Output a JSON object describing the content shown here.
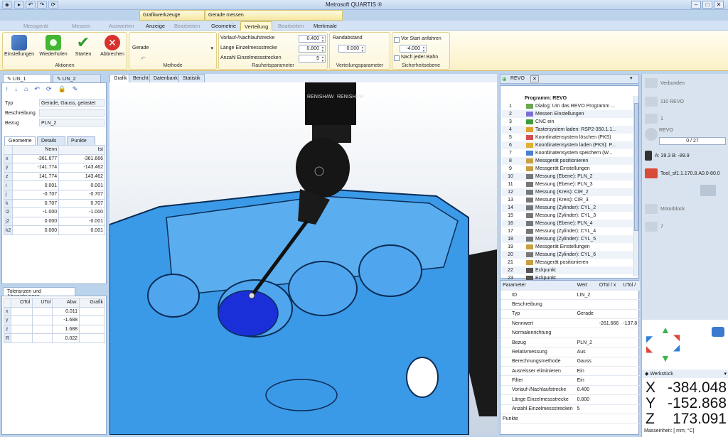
{
  "app": {
    "title": "Metrosoft QUARTIS ®",
    "win": [
      "–",
      "□",
      "✕"
    ]
  },
  "context_tabs": [
    "Grafikwerkzeuge",
    "Gerade messen"
  ],
  "tabs": [
    {
      "label": "Messgerät",
      "state": "dim"
    },
    {
      "label": "Messen",
      "state": "dim"
    },
    {
      "label": "Auswerten",
      "state": "dim"
    },
    {
      "label": "Anzeige",
      "state": ""
    },
    {
      "label": "Bearbeiten",
      "state": "dim"
    },
    {
      "label": "Geometrie",
      "state": ""
    },
    {
      "label": "Verteilung",
      "state": "act"
    },
    {
      "label": "Bearbeiten",
      "state": "dim"
    },
    {
      "label": "Merkmale",
      "state": ""
    }
  ],
  "ribbon": {
    "aktionen": {
      "title": "Aktionen",
      "buttons": [
        "Einstellungen",
        "Wiederholen",
        "Starten",
        "Abbrechen"
      ]
    },
    "methode": {
      "title": "Methode",
      "value": "Gerade"
    },
    "rauheit": {
      "title": "Rauheitsparameter",
      "rows": [
        {
          "label": "Vorlauf-/Nachlaufstrecke",
          "value": "0.400"
        },
        {
          "label": "Länge Einzelmessstrecke",
          "value": "0.800"
        },
        {
          "label": "Anzahl Einzelmessstrecken",
          "value": "5"
        }
      ]
    },
    "verteilung": {
      "title": "Verteilungsparameter",
      "label": "Randabstand",
      "value": "0.000"
    },
    "sicherheit": {
      "title": "Sicherheitsebene",
      "check1": "Vor Start anfahren",
      "value": "-4.000",
      "check2": "Nach jeder Bahn"
    }
  },
  "left": {
    "tabs": [
      "LIN_1",
      "LIN_2"
    ],
    "props": [
      {
        "k": "Typ",
        "v": "Gerade, Gauss, getastet"
      },
      {
        "k": "Beschreibung",
        "v": ""
      },
      {
        "k": "Bezug",
        "v": "PLN_2"
      }
    ],
    "geom_tabs": [
      "Geometrie",
      "Details",
      "Punkte"
    ],
    "geom_head": [
      "Nenn",
      "Ist"
    ],
    "geom": [
      {
        "k": "x",
        "n": "-361.677",
        "i": "-361.666"
      },
      {
        "k": "y",
        "n": "-141.774",
        "i": "-143.462"
      },
      {
        "k": "z",
        "n": "141.774",
        "i": "143.462"
      },
      {
        "k": "i",
        "n": "0.001",
        "i": "0.001"
      },
      {
        "k": "j",
        "n": "-0.707",
        "i": "-0.707"
      },
      {
        "k": "k",
        "n": "0.707",
        "i": "0.707"
      },
      {
        "k": "i2",
        "n": "-1.000",
        "i": "-1.000"
      },
      {
        "k": "j2",
        "n": "0.000",
        "i": "-0.001"
      },
      {
        "k": "k2",
        "n": "0.000",
        "i": "0.001"
      }
    ],
    "tol_title": "Toleranzen und Abweichungen",
    "tol_head": [
      "OTol",
      "UTol",
      "Abw.",
      "Grafik"
    ],
    "tol": [
      {
        "k": "x",
        "a": "0.011"
      },
      {
        "k": "y",
        "a": "-1.688"
      },
      {
        "k": "z",
        "a": "1.688"
      },
      {
        "k": "R",
        "a": "0.022"
      }
    ]
  },
  "view": {
    "tabs": [
      "Grafik",
      "Bericht",
      "Datenbank",
      "Statistik"
    ],
    "brand1": "RENISHAW",
    "brand2": "RENISHAW"
  },
  "program": {
    "tab": "REVO",
    "title": "Programm: REVO",
    "lines": [
      {
        "n": "1",
        "t": "Dialog: Um das REVO Programm ..."
      },
      {
        "n": "2",
        "t": "Messen Einstellungen"
      },
      {
        "n": "3",
        "t": "CNC ein"
      },
      {
        "n": "4",
        "t": "Tastersystem laden: RSP2-350.1.1..."
      },
      {
        "n": "5",
        "t": "Koordinatensystem löschen (PKS)"
      },
      {
        "n": "6",
        "t": "Koordinatensystem laden (PKS): P..."
      },
      {
        "n": "7",
        "t": "Koordinatensystem speichern (W..."
      },
      {
        "n": "8",
        "t": "Messgerät positionieren"
      },
      {
        "n": "9",
        "t": "Messgerät Einstellungen"
      },
      {
        "n": "10",
        "t": "Messung (Ebene): PLN_2"
      },
      {
        "n": "11",
        "t": "Messung (Ebene): PLN_3"
      },
      {
        "n": "12",
        "t": "Messung (Kreis): CIR_2"
      },
      {
        "n": "13",
        "t": "Messung (Kreis): CIR_3"
      },
      {
        "n": "14",
        "t": "Messung (Zylinder): CYL_2"
      },
      {
        "n": "15",
        "t": "Messung (Zylinder): CYL_3"
      },
      {
        "n": "16",
        "t": "Messung (Ebene): PLN_4"
      },
      {
        "n": "17",
        "t": "Messung (Zylinder): CYL_4"
      },
      {
        "n": "18",
        "t": "Messung (Zylinder): CYL_5"
      },
      {
        "n": "19",
        "t": "Messgerät Einstellungen"
      },
      {
        "n": "20",
        "t": "Messung (Zylinder): CYL_6"
      },
      {
        "n": "21",
        "t": "Messgerät positionieren"
      },
      {
        "n": "22",
        "t": "Eckpunkt"
      },
      {
        "n": "23",
        "t": "Eckpunkt"
      }
    ]
  },
  "params": {
    "head": [
      "Parameter",
      "Wert",
      "OTol / x",
      "UTol /"
    ],
    "rows": [
      {
        "k": "ID",
        "v": "LIN_2",
        "o": "",
        "u": ""
      },
      {
        "k": "Beschreibung",
        "v": "",
        "o": "",
        "u": ""
      },
      {
        "k": "Typ",
        "v": "Gerade",
        "o": "",
        "u": ""
      },
      {
        "k": "Nennwert",
        "v": "",
        "o": "-261.666",
        "u": "-137.8"
      },
      {
        "k": "Normalenrichtung",
        "v": "",
        "o": "",
        "u": ""
      },
      {
        "k": "Bezug",
        "v": "PLN_2",
        "o": "",
        "u": ""
      },
      {
        "k": "Relativmessung",
        "v": "Aus",
        "o": "",
        "u": ""
      },
      {
        "k": "Berechnungsmethode",
        "v": "Gauss",
        "o": "",
        "u": ""
      },
      {
        "k": "Ausreisser eliminieren",
        "v": "Ein",
        "o": "",
        "u": ""
      },
      {
        "k": "Filter",
        "v": "Ein",
        "o": "",
        "u": ""
      },
      {
        "k": "Vorlauf-/Nachlaufstrecke",
        "v": "0.400",
        "o": "",
        "u": ""
      },
      {
        "k": "Länge Einzelmessstrecke",
        "v": "0.800",
        "o": "",
        "u": ""
      },
      {
        "k": "Anzahl Einzelmessstrecken",
        "v": "5",
        "o": "",
        "u": ""
      },
      {
        "k": "Punkte",
        "v": "",
        "o": "",
        "u": ""
      }
    ]
  },
  "side": {
    "verbunden": "Verbunden",
    "revo110": "110 REVO",
    "one": "1",
    "revo": "REVO",
    "progress": "0 / 27",
    "angles": "A: 39.3   B: -89.9",
    "tool": "Tool_sf1.1.170.8.A0.0-80.0",
    "motorblock": "Motorblock",
    "seven": "7",
    "werkstueck": "Werkstück",
    "coords": [
      {
        "axis": "X",
        "val": "-384.048"
      },
      {
        "axis": "Y",
        "val": "-152.868"
      },
      {
        "axis": "Z",
        "val": "173.091"
      }
    ],
    "unit": "Masseinheit: [ mm; °C]"
  },
  "colors": {
    "part": "#3b9ae8",
    "bore": "#1a2fd8",
    "ribbon": "#fbf1c7"
  }
}
